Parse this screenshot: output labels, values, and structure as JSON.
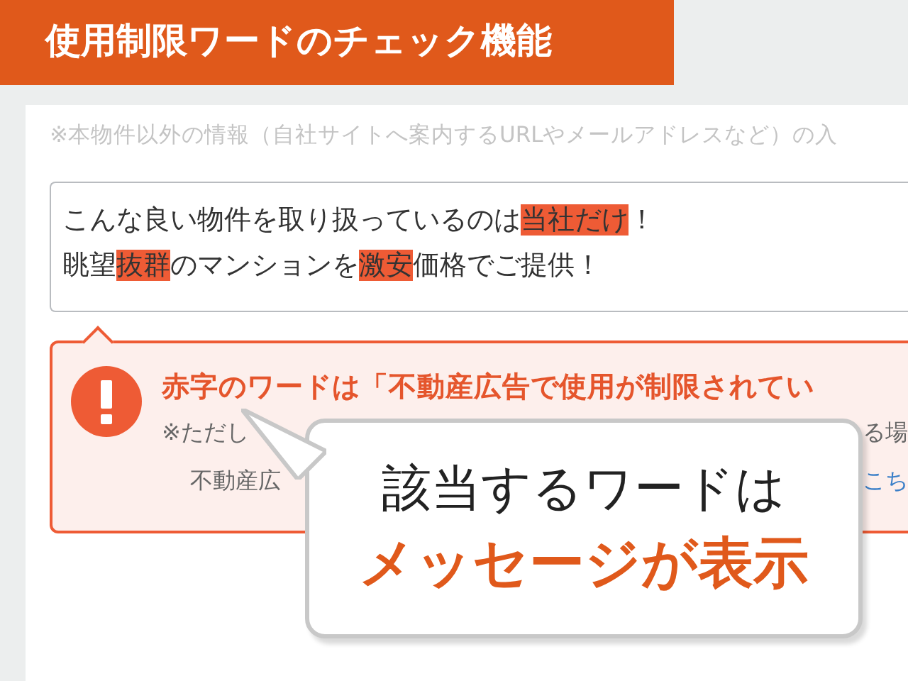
{
  "banner": {
    "title": "使用制限ワードのチェック機能"
  },
  "hint": "※本物件以外の情報（自社サイトへ案内するURLやメールアドレスなど）の入",
  "textarea": {
    "lines": [
      [
        {
          "text": "こんな良い物件を取り扱っているのは",
          "flagged": false
        },
        {
          "text": "当社だけ",
          "flagged": true
        },
        {
          "text": "！",
          "flagged": false
        }
      ],
      [
        {
          "text": "眺望",
          "flagged": false
        },
        {
          "text": "抜群",
          "flagged": true
        },
        {
          "text": "のマンションを",
          "flagged": false
        },
        {
          "text": "激安",
          "flagged": true
        },
        {
          "text": "価格でご提供！",
          "flagged": false
        }
      ]
    ]
  },
  "alert": {
    "title": "赤字のワードは「不動産広告で使用が制限されてい",
    "rows": [
      [
        {
          "text": "※ただし",
          "kind": "text"
        },
        {
          "text": "る場",
          "kind": "text"
        }
      ],
      [
        {
          "text": "不動産広",
          "kind": "text"
        },
        {
          "text": "こち",
          "kind": "link"
        }
      ]
    ]
  },
  "callout": {
    "line1": "該当するワードは",
    "line2": "メッセージが表示"
  }
}
